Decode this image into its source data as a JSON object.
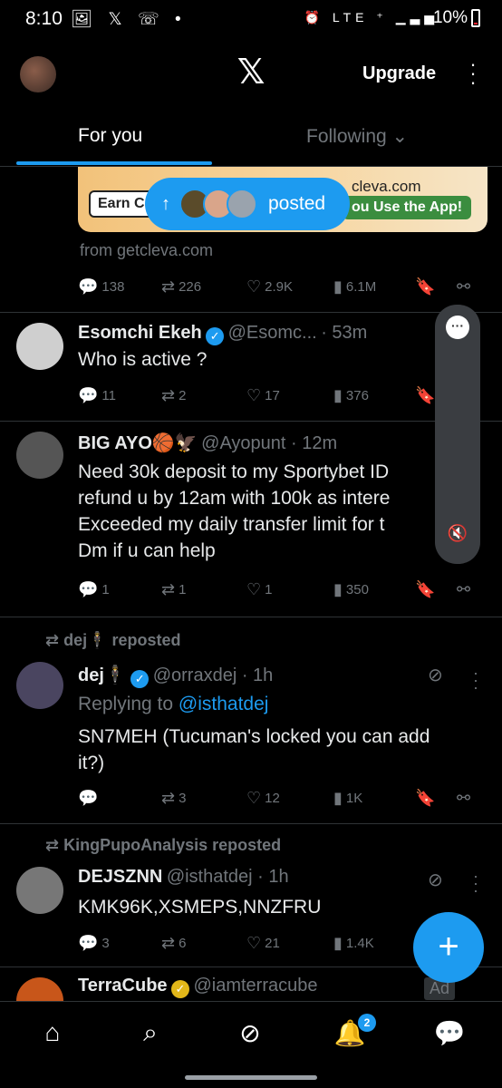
{
  "status_bar": {
    "time": "8:10",
    "left_icons": "🖼 𝕏 ☏ •",
    "right_icons": "⏰ LTE ⁺ ▁▃▅",
    "battery": "10%"
  },
  "header": {
    "logo": "𝕏",
    "upgrade_label": "Upgrade",
    "menu_icon": "⋮"
  },
  "tabs": {
    "for_you": "For you",
    "following": "Following ⌄"
  },
  "ad_banner": {
    "left_text": "Earn C",
    "site_text": "cleva.com",
    "right_text": "ou Use the App!",
    "from": "from getcleva.com"
  },
  "new_posts_pill": {
    "arrow": "↑",
    "label": "posted"
  },
  "posts": [
    {
      "id": "ad-metrics",
      "replies": "138",
      "reposts": "226",
      "likes": "2.9K",
      "views": "6.1M"
    },
    {
      "id": "esomchi",
      "name": "Esomchi Ekeh",
      "handle": "@Esomc...",
      "time": "· 53m",
      "text": "Who is active ?",
      "replies": "11",
      "reposts": "2",
      "likes": "17",
      "views": "376"
    },
    {
      "id": "bigayo",
      "name": "BIG AYO🏀🦅",
      "handle": "@Ayopunt · 12m",
      "text": "Need 30k deposit to my Sportybet ID\nrefund u by 12am with 100k as intere\nExceeded my daily transfer limit for t\nDm if u can help",
      "replies": "1",
      "reposts": "1",
      "likes": "1",
      "views": "350"
    },
    {
      "id": "dej",
      "repost_by": "dej🕴 reposted",
      "name": "dej🕴",
      "handle": "@orraxdej · 1h",
      "replying_prefix": "Replying to ",
      "replying_to": "@isthatdej",
      "text": "SN7MEH (Tucuman's locked you can add it?)",
      "replies": "",
      "reposts": "3",
      "likes": "12",
      "views": "1K"
    },
    {
      "id": "dejsznn",
      "repost_by": "KingPupoAnalysis reposted",
      "name": "DEJSZNN",
      "handle": "@isthatdej · 1h",
      "text": "KMK96K,XSMEPS,NNZFRU",
      "replies": "3",
      "reposts": "6",
      "likes": "21",
      "views": "1.4K"
    },
    {
      "id": "terracube",
      "name": "TerraCube",
      "handle": "@iamterracube",
      "ad_label": "Ad"
    }
  ],
  "bottom_nav": {
    "notif_count": "2"
  },
  "compose_icon": "+"
}
